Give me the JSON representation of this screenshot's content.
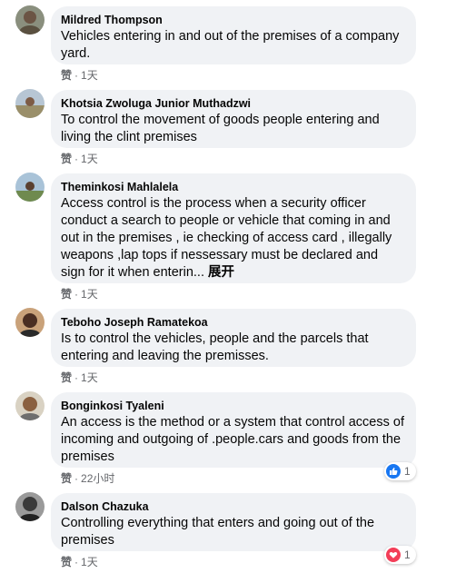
{
  "comments": [
    {
      "name": "Mildred Thompson",
      "text": "Vehicles entering in and out of the premises of a company yard.",
      "like_label": "赞",
      "time": "1天"
    },
    {
      "name": "Khotsia Zwoluga Junior Muthadzwi",
      "text": "To control the movement of goods people entering and living the clint premises",
      "like_label": "赞",
      "time": "1天"
    },
    {
      "name": "Theminkosi Mahlalela",
      "text": "Access control is the process when a security officer conduct a search to people or vehicle that coming in and out in the premises , ie checking of access card , illegally weapons ,lap tops if nessessary must be declared and sign for it when enterin...",
      "more_label": "展开",
      "like_label": "赞",
      "time": "1天"
    },
    {
      "name": "Teboho Joseph Ramatekoa",
      "text": "Is to control the vehicles, people and the parcels that entering and leaving the premisses.",
      "like_label": "赞",
      "time": "1天"
    },
    {
      "name": "Bonginkosi Tyaleni",
      "text": "An access is the method or a system that control access of incoming and outgoing of .people.cars and goods from the premises",
      "like_label": "赞",
      "time": "22小时",
      "reaction": {
        "icon": "thumbs-up-icon",
        "count": "1",
        "color": "#1877f2"
      }
    },
    {
      "name": "Dalson Chazuka",
      "text": "Controlling everything that enters and going out of the premises",
      "like_label": "赞",
      "time": "1天",
      "reaction": {
        "icon": "heart-icon",
        "count": "1",
        "color": "#f33e58"
      }
    }
  ],
  "separator": "·"
}
